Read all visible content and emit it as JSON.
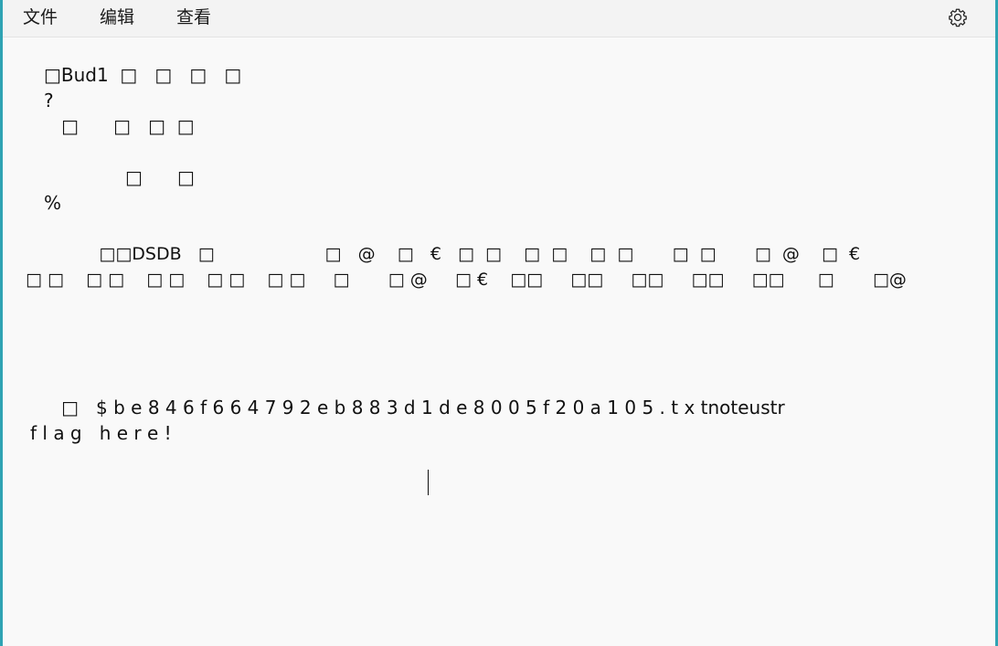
{
  "menu": {
    "file": "文件",
    "edit": "编辑",
    "view": "查看"
  },
  "toolbar": {
    "settings_icon": "gear-icon"
  },
  "editor": {
    "lines": [
      "□Bud1  □   □   □   □",
      "?",
      "   □      □   □  □",
      "              □      □",
      "%",
      "          □□DSDB   □                    □   @    □   €   □  □    □  □    □  □       □  □       □  @    □  €",
      "□ □    □ □    □ □    □ □    □ □     □       □ @     □ €    □□     □□     □□     □□     □□      □       □@",
      "   □   $ b e 8 4 6 f 6 6 4 7 9 2 e b 8 8 3 d 1 d e 8 0 0 5 f 2 0 a 1 0 5 . t x tnoteustr",
      "f l a g   h e r e !"
    ]
  }
}
